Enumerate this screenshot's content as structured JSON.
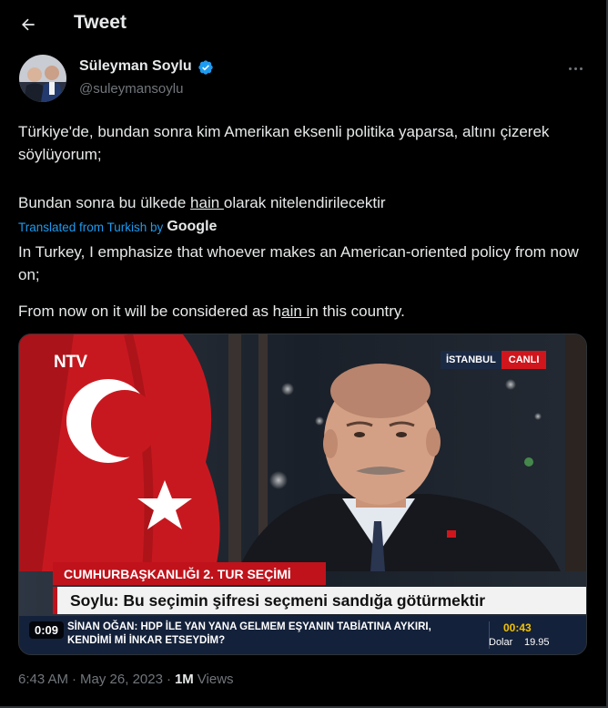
{
  "header": {
    "back_icon": "arrow-left-icon",
    "title": "Tweet"
  },
  "author": {
    "name": "Süleyman Soylu",
    "handle": "@suleymansoylu",
    "verified_icon": "verified-badge-icon",
    "verified_color": "#1d9bf0",
    "more_icon": "more-horizontal-icon"
  },
  "tweet": {
    "line1": "Türkiye'de, bundan sonra kim Amerikan eksenli politika yaparsa, altını çizerek söylüyorum;",
    "line2_prefix": "Bundan sonra bu ülkede ",
    "line2_underlined": "hain ",
    "line2_suffix": "olarak nitelendirilecektir",
    "translated_label": "Translated from Turkish by",
    "translated_provider": "Google",
    "translation_line1": "In Turkey, I emphasize that whoever makes an American-oriented policy from now on;",
    "translation_line2_prefix": "From now on it will be considered as h",
    "translation_line2_underlined": "ain i",
    "translation_line2_suffix": "n this country."
  },
  "media": {
    "channel_logo": "NTV",
    "location": "İSTANBUL",
    "live_label": "CANLI",
    "lower_third_title": "CUMHURBAŞKANLIĞI 2. TUR SEÇİMİ",
    "lower_third_headline": "Soylu: Bu seçimin şifresi seçmeni sandığa götürmektir",
    "ticker_text": "SİNAN OĞAN: HDP İLE YAN YANA GELMEM EŞYANIN TABİATINA AYKIRI, KENDİMİ Mİ İNKAR ETSEYDİM?",
    "ticker_time": "00:43",
    "ticker_currency_label": "Dolar",
    "ticker_currency_value": "19.95",
    "video_timer": "0:09",
    "accent_red": "#c0121b",
    "ticker_bg": "#14213a"
  },
  "meta": {
    "time": "6:43 AM",
    "separator": "·",
    "date": "May 26, 2023",
    "views_count": "1M",
    "views_label": "Views"
  }
}
